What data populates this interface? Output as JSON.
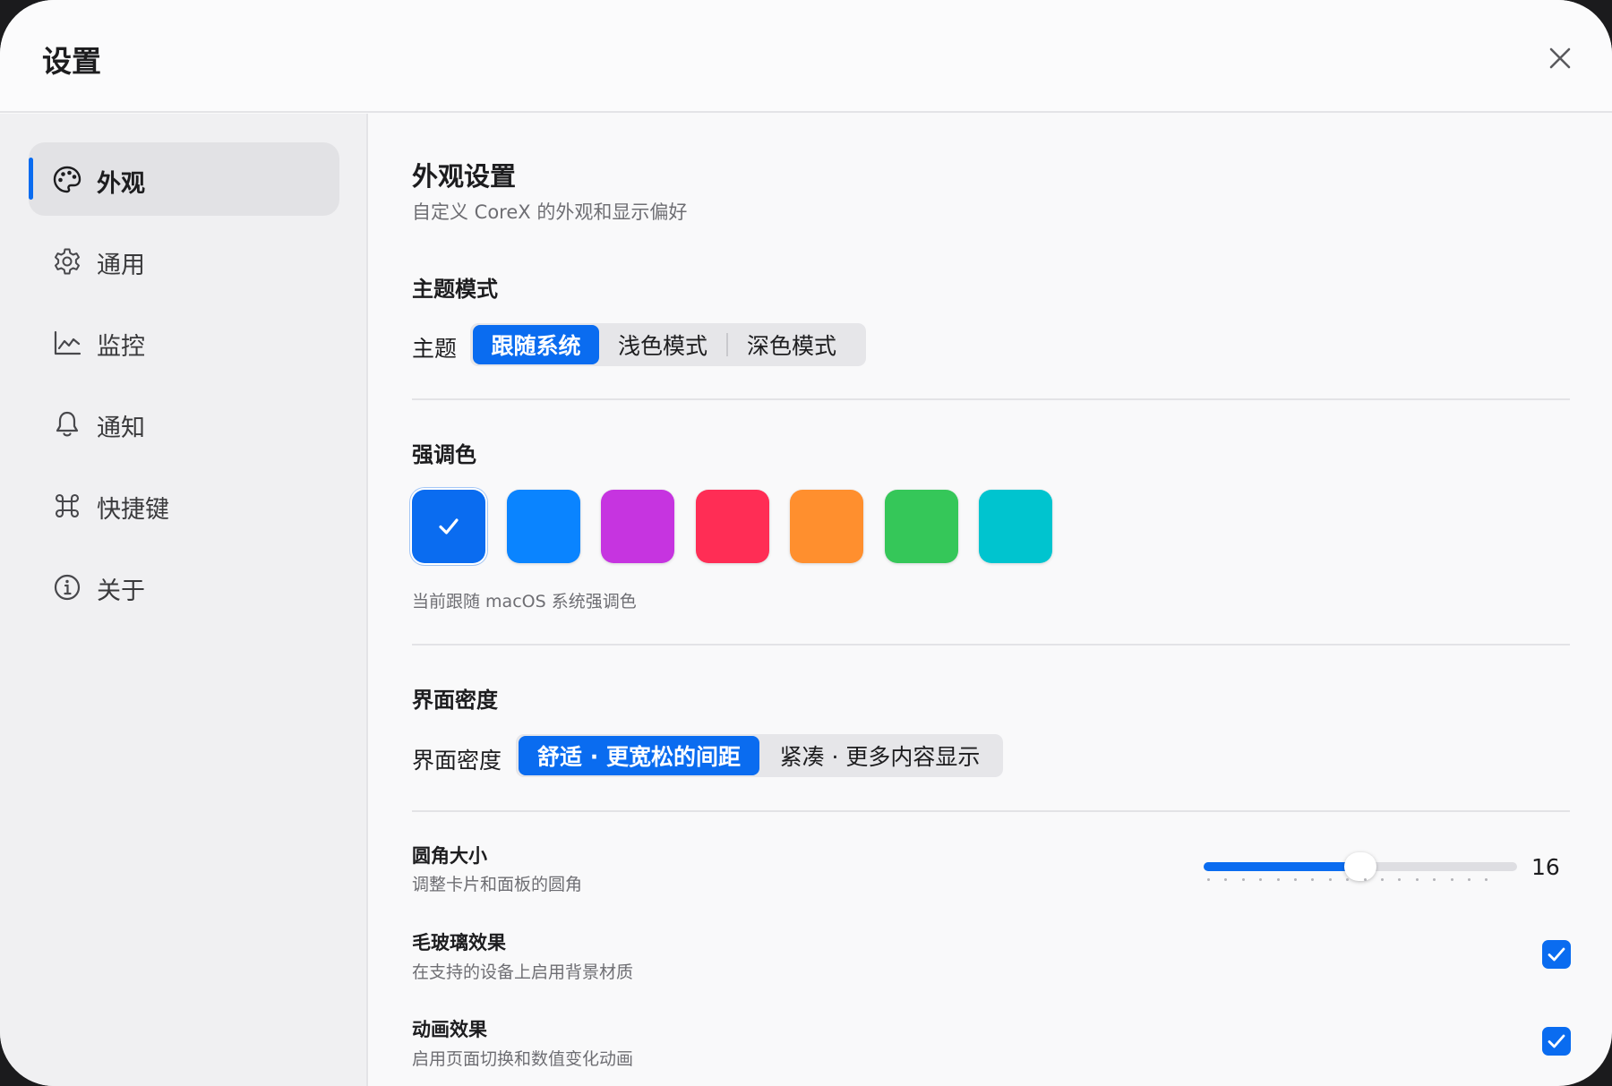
{
  "window": {
    "title": "设置",
    "close_icon": "close-icon"
  },
  "sidebar": {
    "items": [
      {
        "label": "外观",
        "icon": "palette-icon",
        "active": true
      },
      {
        "label": "通用",
        "icon": "gear-icon",
        "active": false
      },
      {
        "label": "监控",
        "icon": "chart-line-icon",
        "active": false
      },
      {
        "label": "通知",
        "icon": "bell-icon",
        "active": false
      },
      {
        "label": "快捷键",
        "icon": "command-icon",
        "active": false
      },
      {
        "label": "关于",
        "icon": "info-icon",
        "active": false
      }
    ]
  },
  "content": {
    "title": "外观设置",
    "subtitle": "自定义 CoreX 的外观和显示偏好",
    "theme": {
      "section_title": "主题模式",
      "label": "主题",
      "options": [
        "跟随系统",
        "浅色模式",
        "深色模式"
      ],
      "selected": "跟随系统"
    },
    "accent": {
      "section_title": "强调色",
      "swatches": [
        {
          "color": "#0a6cf0",
          "selected": true
        },
        {
          "color": "#0a84ff",
          "selected": false
        },
        {
          "color": "#c634e0",
          "selected": false
        },
        {
          "color": "#ff2d55",
          "selected": false
        },
        {
          "color": "#ff8f2e",
          "selected": false
        },
        {
          "color": "#35c759",
          "selected": false
        },
        {
          "color": "#00c4cf",
          "selected": false
        }
      ],
      "hint": "当前跟随 macOS 系统强调色"
    },
    "density": {
      "section_title": "界面密度",
      "label": "界面密度",
      "options": [
        "舒适 · 更宽松的间距",
        "紧凑 · 更多内容显示"
      ],
      "selected": "舒适 · 更宽松的间距"
    },
    "corner_radius": {
      "title": "圆角大小",
      "description": "调整卡片和面板的圆角",
      "value": 16,
      "value_text": "16",
      "fill_fraction": 0.5
    },
    "frosted_glass": {
      "title": "毛玻璃效果",
      "description": "在支持的设备上启用背景材质",
      "checked": true
    },
    "animation": {
      "title": "动画效果",
      "description": "启用页面切换和数值变化动画",
      "checked": true
    }
  },
  "colors": {
    "accent": "#0a6cf0",
    "checkbox": "#0a6cf0"
  }
}
